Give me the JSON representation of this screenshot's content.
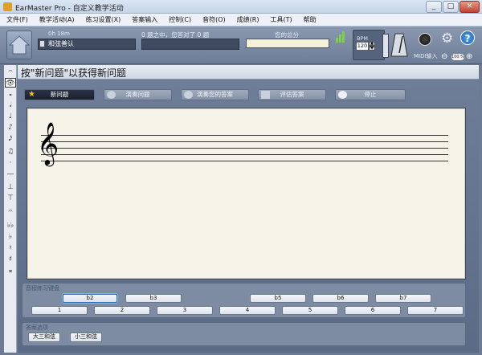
{
  "window": {
    "title": "EarMaster Pro - 自定义教学活动",
    "controls": [
      "_",
      "□",
      "✕"
    ]
  },
  "menu": [
    "文件(F)",
    "教学活动(A)",
    "练习设置(X)",
    "答案输入",
    "控制(C)",
    "音符(O)",
    "成绩(R)",
    "工具(T)",
    "帮助"
  ],
  "top_panel": {
    "timer": "0h 18m",
    "lesson_name": "和弦善认",
    "progress_text": "0 题之中，您答对了 0 题",
    "score_label": "您的总分",
    "bpm_label": "BPM",
    "bpm_value": "120",
    "midi_label": "MIDI输入",
    "zoom_value": "100 %"
  },
  "left_toolbar": [
    "𝄐",
    "👁",
    "𝅝",
    "𝅗𝅥",
    "♩",
    "♪",
    "𝅘𝅥𝅯",
    "♫",
    "·",
    "—",
    "⊥",
    "⊤",
    "𝄐",
    "♭♭",
    "♭",
    "♮",
    "♯",
    "𝄪"
  ],
  "main": {
    "instruction": "按\"新问题\"以获得新问题",
    "buttons": {
      "new": "新问题",
      "play_question": "演奏问题",
      "play_answer": "演奏您的答案",
      "evaluate": "评估答案",
      "stop": "停止"
    }
  },
  "answer_panel": {
    "title": "音程练习键盘",
    "row1": [
      "b2",
      "b3",
      "b5",
      "b6",
      "b7"
    ],
    "row2": [
      "1",
      "2",
      "3",
      "4",
      "5",
      "6",
      "7"
    ]
  },
  "options_panel": {
    "title": "答案选项",
    "buttons": [
      "大三和弦",
      "小三和弦"
    ]
  },
  "colors": {
    "panel_bg": "#6c7a93",
    "staff_bg": "#f6f3e9",
    "active_button": "#1b202c"
  }
}
